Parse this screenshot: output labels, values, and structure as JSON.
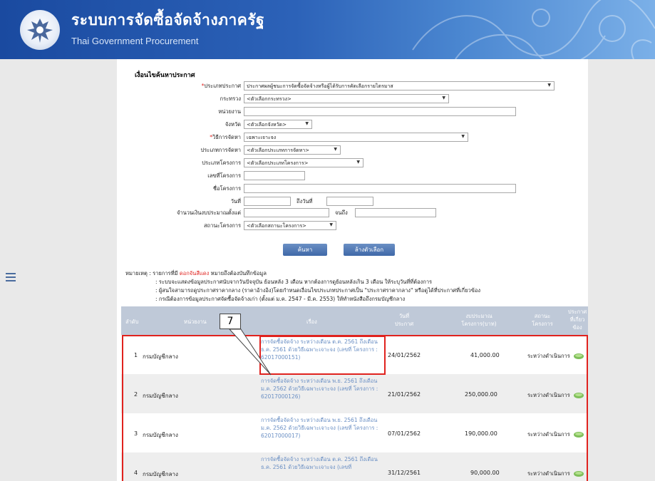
{
  "header": {
    "title": "ระบบการจัดซื้อจัดจ้างภาครัฐ",
    "subtitle": "Thai Government Procurement"
  },
  "form": {
    "title": "เงื่อนไขค้นหาประกาศ",
    "announce_type": {
      "label": "ประเภทประกาศ",
      "value": "ประกาศผลผู้ชนะการจัดซื้อจัดจ้างหรือผู้ได้รับการคัดเลือกรายไตรมาส"
    },
    "ministry": {
      "label": "กระทรวง",
      "value": "<ตัวเลือกกระทรวง>"
    },
    "agency": {
      "label": "หน่วยงาน",
      "value": ""
    },
    "province": {
      "label": "จังหวัด",
      "value": "<ตัวเลือกจังหวัด>"
    },
    "method": {
      "label": "วิธีการจัดหา",
      "value": "เฉพาะเจาะจง"
    },
    "procure_type": {
      "label": "ประเภทการจัดหา",
      "value": "<ตัวเลือกประเภทการจัดหา>"
    },
    "project_type": {
      "label": "ประเภทโครงการ",
      "value": "<ตัวเลือกประเภทโครงการ>"
    },
    "project_no": {
      "label": "เลขที่โครงการ",
      "value": ""
    },
    "project_name": {
      "label": "ชื่อโครงการ",
      "value": ""
    },
    "date": {
      "label": "วันที่",
      "value": "",
      "to_label": "ถึงวันที่",
      "to_value": ""
    },
    "budget": {
      "label": "จำนวนเงินงบประมาณตั้งแต่",
      "value": "",
      "to_label": "จนถึง",
      "to_value": ""
    },
    "status": {
      "label": "สถานะโครงการ",
      "value": "<ตัวเลือกสถานะโครงการ>"
    },
    "search_button": "ค้นหา",
    "clear_button": "ล้างตัวเลือก"
  },
  "notes": {
    "prefix": "หมายเหตุ : รายการที่มี",
    "red": "ดอกจันสีแดง",
    "suffix": "หมายถึงต้องบันทึกข้อมูล",
    "line2": ": ระบบจะแสดงข้อมูลประกาศนับจากวันปัจจุบัน ย้อนหลัง 3 เดือน หากต้องการดูย้อนหลังเกิน 3 เดือน ให้ระบุวันที่ที่ต้องการ",
    "line3": ": ผู้สนใจสามารถดูประกาศราคากลาง (ราคาอ้างอิง)โดยกำหนดเงื่อนไขประเภทประกาศเป็น \"ประกาศราคากลาง\" หรือดูได้ที่ประกาศที่เกี่ยวข้อง",
    "line4": ": กรณีต้องการข้อมูลประกาศจัดซื้อจัดจ้างเก่า (ตั้งแต่ ม.ค. 2547 - มี.ค. 2553) ให้ทำหนังสือถึงกรมบัญชีกลาง"
  },
  "table": {
    "headers": {
      "no": "ลำดับ",
      "agency": "หน่วยงาน",
      "subject": "เรื่อง",
      "date_l1": "วันที่",
      "date_l2": "ประกาศ",
      "budget_l1": "งบประมาณ",
      "budget_l2": "โครงการ(บาท)",
      "status_l1": "สถานะ",
      "status_l2": "โครงการ",
      "related_l1": "ประกาศ",
      "related_l2": "ที่เกี่ยว",
      "related_l3": "ข้อง"
    },
    "rows": [
      {
        "no": "1",
        "agency": "กรมบัญชีกลาง",
        "subject": "การจัดซื้อจัดจ้าง ระหว่างเดือน ต.ค. 2561 ถึงเดือน ธ.ค. 2561 ด้วยวิธีเฉพาะเจาะจง (เลขที่ โครงการ : 62017000151)",
        "date": "24/01/2562",
        "budget": "41,000.00",
        "status": "ระหว่างดำเนินการ"
      },
      {
        "no": "2",
        "agency": "กรมบัญชีกลาง",
        "subject": "การจัดซื้อจัดจ้าง ระหว่างเดือน พ.ย. 2561 ถึงเดือน ม.ค. 2562 ด้วยวิธีเฉพาะเจาะจง (เลขที่ โครงการ : 62017000126)",
        "date": "21/01/2562",
        "budget": "250,000.00",
        "status": "ระหว่างดำเนินการ"
      },
      {
        "no": "3",
        "agency": "กรมบัญชีกลาง",
        "subject": "การจัดซื้อจัดจ้าง ระหว่างเดือน พ.ย. 2561 ถึงเดือน ม.ค. 2562 ด้วยวิธีเฉพาะเจาะจง (เลขที่ โครงการ : 62017000017)",
        "date": "07/01/2562",
        "budget": "190,000.00",
        "status": "ระหว่างดำเนินการ"
      },
      {
        "no": "4",
        "agency": "กรมบัญชีกลาง",
        "subject": "การจัดซื้อจัดจ้าง ระหว่างเดือน ต.ค. 2561 ถึงเดือน ธ.ค. 2561 ด้วยวิธีเฉพาะเจาะจง (เลขที่",
        "date": "31/12/2561",
        "budget": "90,000.00",
        "status": "ระหว่างดำเนินการ"
      }
    ]
  },
  "callout": {
    "label": "7"
  },
  "colors": {
    "header": "#2c62b8",
    "accent": "#e0221e",
    "link": "#6a8fc4"
  }
}
